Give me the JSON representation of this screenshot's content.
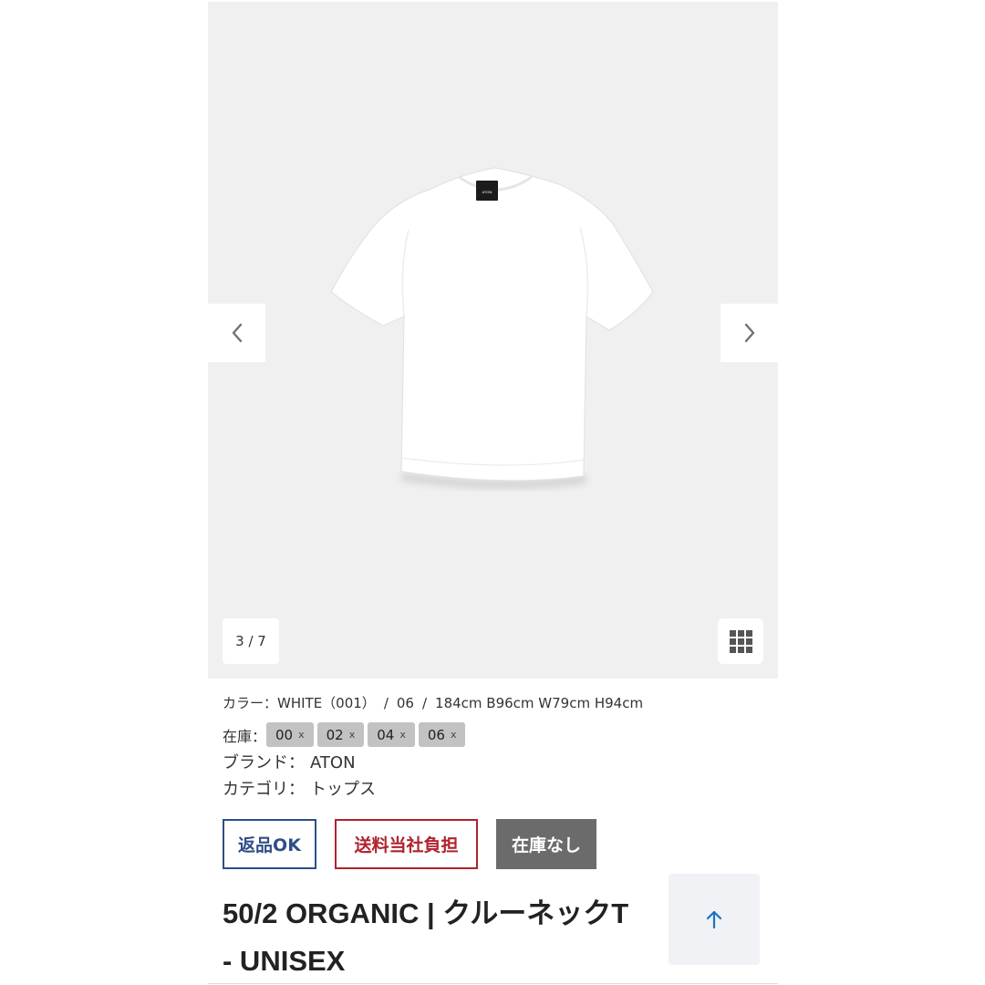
{
  "gallery": {
    "counter": "3 / 7",
    "product_tag_text": "ATON"
  },
  "details": {
    "color_label": "カラー：WHITE（001）",
    "separator": "/",
    "size": "06",
    "model_info": "184cm B96cm W79cm H94cm",
    "stock_label": "在庫：",
    "stock_sizes": [
      {
        "size": "00",
        "mark": "x"
      },
      {
        "size": "02",
        "mark": "x"
      },
      {
        "size": "04",
        "mark": "x"
      },
      {
        "size": "06",
        "mark": "x"
      }
    ],
    "brand_label": "ブランド：",
    "brand_value": "ATON",
    "category_label": "カテゴリ：",
    "category_value": "トップス"
  },
  "badges": {
    "return": "返品OK",
    "shipping": "送料当社負担",
    "stock": "在庫なし"
  },
  "product": {
    "title_line1": "50/2 ORGANIC | クルーネックT",
    "title_line2": "- UNISEX"
  },
  "colors": {
    "gallery_bg": "#f0f0f0",
    "return_badge": "#2f4e86",
    "shipping_badge": "#b0222d",
    "stock_badge": "#6b6b6b",
    "back_to_top_arrow": "#1a73c8"
  },
  "icons": {
    "prev": "chevron-left-icon",
    "next": "chevron-right-icon",
    "grid": "grid-icon",
    "back_to_top": "arrow-up-icon"
  }
}
